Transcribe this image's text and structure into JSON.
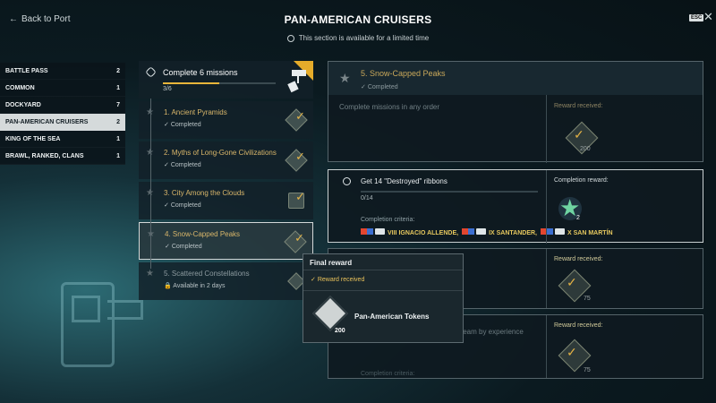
{
  "header": {
    "back_label": "Back to Port",
    "title": "PAN-AMERICAN CRUISERS",
    "limited_notice": "This section is available for a limited time",
    "esc_label": "ESC"
  },
  "sidebar": {
    "items": [
      {
        "label": "BATTLE PASS",
        "count": "2"
      },
      {
        "label": "COMMON",
        "count": "1"
      },
      {
        "label": "DOCKYARD",
        "count": "7"
      },
      {
        "label": "PAN-AMERICAN CRUISERS",
        "count": "2"
      },
      {
        "label": "KING OF THE SEA",
        "count": "1"
      },
      {
        "label": "BRAWL, RANKED, CLANS",
        "count": "1"
      }
    ]
  },
  "chain": {
    "name": "Complete 6 missions",
    "progress_text": "3/6",
    "progress": 0.5,
    "steps": [
      {
        "label": "1. Ancient Pyramids",
        "status": "Completed"
      },
      {
        "label": "2. Myths of Long-Gone Civilizations",
        "status": "Completed"
      },
      {
        "label": "3. City Among the Clouds",
        "status": "Completed"
      },
      {
        "label": "4. Snow-Capped Peaks",
        "status": "Completed"
      },
      {
        "label": "5. Scattered Constellations",
        "status": "Available in 2 days"
      }
    ]
  },
  "detail": {
    "title": "5. Snow-Capped Peaks",
    "status": "Completed",
    "description": "Complete missions in any order",
    "reward_received_label": "Reward received:",
    "reward_amount": "200"
  },
  "task": {
    "title": "Get 14 \"Destroyed\" ribbons",
    "progress_text": "0/14",
    "completion_criteria_label": "Completion criteria:",
    "ships": [
      "VIII IGNACIO ALLENDE,",
      "IX SANTANDER,",
      "X SAN MARTÍN"
    ],
    "completion_reward_label": "Completion reward:",
    "reward_count": "2"
  },
  "task3": {
    "reward_received_label": "Reward received:",
    "reward_amount": "75"
  },
  "task4": {
    "title_fragment": "team by experience",
    "completion_criteria_label": "Completion criteria:",
    "reward_received_label": "Reward received:",
    "reward_amount": "75"
  },
  "tooltip": {
    "title": "Final reward",
    "received": "Reward received",
    "token_amount": "200",
    "token_name": "Pan-American Tokens"
  },
  "colors": {
    "accent_gold": "#e6ac2a",
    "active_tab_bg": "#d5dadb",
    "teal_glow": "#2c6a73"
  }
}
